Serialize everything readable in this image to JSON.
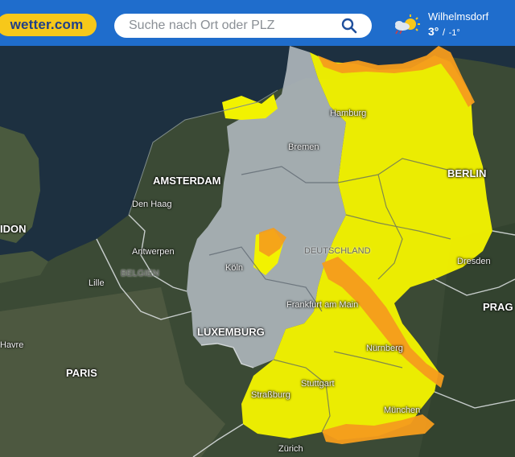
{
  "header": {
    "logo_text": "wetter.com",
    "search": {
      "placeholder": "Suche nach Ort oder PLZ"
    },
    "weather": {
      "location": "Wilhelmsdorf",
      "temp_max": "3°",
      "separator": "/",
      "temp_min": "-1°",
      "icon": "sun-cloud-icon"
    }
  },
  "map": {
    "labels": {
      "hamburg": "Hamburg",
      "bremen": "Bremen",
      "berlin": "BERLIN",
      "amsterdam": "AMSTERDAM",
      "den_haag": "Den Haag",
      "london": "IDON",
      "antwerpen": "Antwerpen",
      "belgien": "BELGIEN",
      "lille": "Lille",
      "koeln": "Köln",
      "deutschland": "DEUTSCHLAND",
      "dresden": "Dresden",
      "frankfurt": "Frankfurt am Main",
      "prag": "PRAG",
      "luxemburg": "LUXEMBURG",
      "havre": "Havre",
      "paris": "PARIS",
      "nuernberg": "Nürnberg",
      "stuttgart": "Stuttgart",
      "strassburg": "Straßburg",
      "muenchen": "München",
      "zuerich": "Zürich"
    },
    "colors": {
      "ocean": "#1d3040",
      "land": "#3b4a35",
      "no_warning": "#a9b1b6",
      "warning_yellow": "#f2f200",
      "warning_orange": "#f59c1c",
      "header": "#1f6dcc",
      "logo": "#f7c81a"
    }
  }
}
